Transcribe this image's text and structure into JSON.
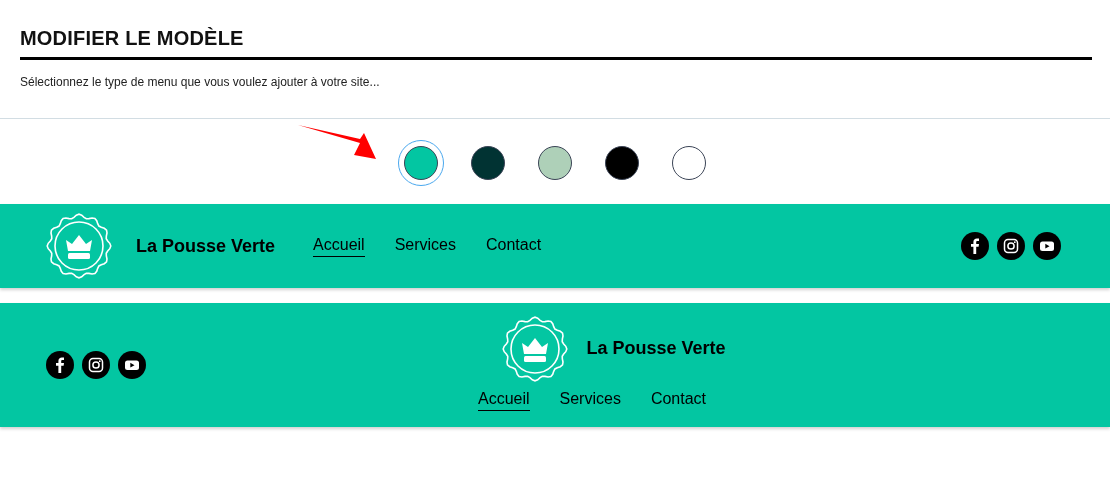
{
  "title": "MODIFIER LE MODÈLE",
  "description": "Sélectionnez le type de menu que vous voulez ajouter à votre site...",
  "swatches": [
    {
      "color": "#03c6a2",
      "selected": true
    },
    {
      "color": "#013333",
      "selected": false
    },
    {
      "color": "#aed0b8",
      "selected": false
    },
    {
      "color": "#000000",
      "selected": false
    },
    {
      "color": "#ffffff",
      "selected": false
    }
  ],
  "menus": [
    {
      "kind": "inline",
      "brand": "La Pousse Verte",
      "links": [
        {
          "label": "Accueil",
          "selected": true
        },
        {
          "label": "Services",
          "selected": false
        },
        {
          "label": "Contact",
          "selected": false
        }
      ],
      "social": [
        {
          "kind": "facebook"
        },
        {
          "kind": "instagram"
        },
        {
          "kind": "youtube"
        }
      ]
    },
    {
      "kind": "centered",
      "brand": "La Pousse Verte",
      "links": [
        {
          "label": "Accueil",
          "selected": true
        },
        {
          "label": "Services",
          "selected": false
        },
        {
          "label": "Contact",
          "selected": false
        }
      ],
      "social": [
        {
          "kind": "facebook"
        },
        {
          "kind": "instagram"
        },
        {
          "kind": "youtube"
        }
      ]
    }
  ]
}
